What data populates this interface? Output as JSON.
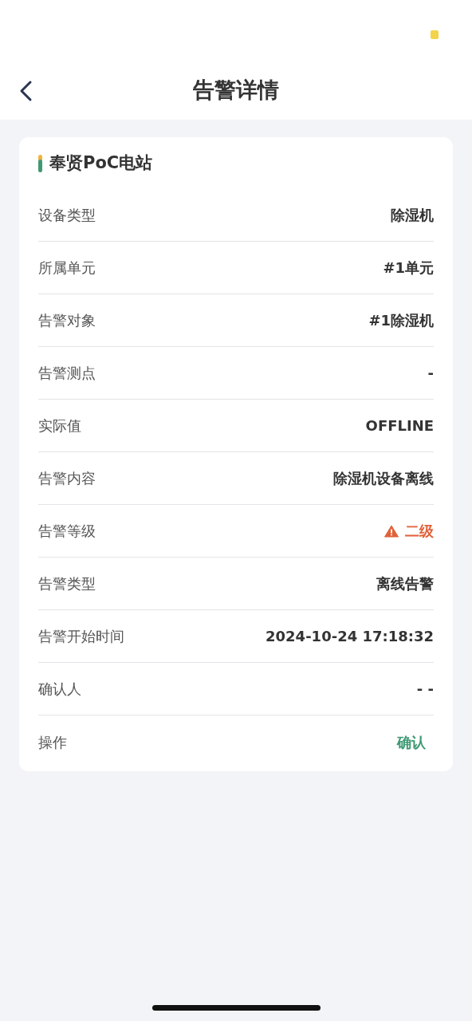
{
  "header": {
    "title": "告警详情"
  },
  "station": {
    "name": "奉贤PoC电站"
  },
  "rows": [
    {
      "kind": "text",
      "label": "设备类型",
      "value": "除湿机"
    },
    {
      "kind": "text",
      "label": "所属单元",
      "value": "#1单元"
    },
    {
      "kind": "text",
      "label": "告警对象",
      "value": "#1除湿机"
    },
    {
      "kind": "text",
      "label": "告警测点",
      "value": "-"
    },
    {
      "kind": "text",
      "label": "实际值",
      "value": "OFFLINE"
    },
    {
      "kind": "text",
      "label": "告警内容",
      "value": "除湿机设备离线"
    },
    {
      "kind": "level",
      "label": "告警等级",
      "value": "二级",
      "color": "#e0623a"
    },
    {
      "kind": "text",
      "label": "告警类型",
      "value": "离线告警"
    },
    {
      "kind": "text",
      "label": "告警开始时间",
      "value": "2024-10-24 17:18:32"
    },
    {
      "kind": "text",
      "label": "确认人",
      "value": "- -"
    },
    {
      "kind": "action",
      "label": "操作",
      "value": "确认"
    }
  ]
}
